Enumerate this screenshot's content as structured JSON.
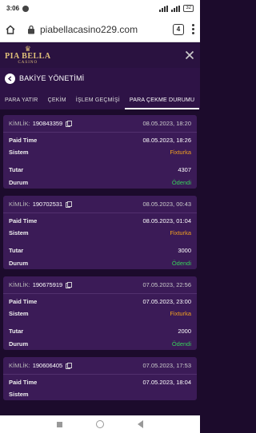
{
  "statusbar": {
    "time": "3:06",
    "battery": "32"
  },
  "browser": {
    "url": "piabellacasino229.com",
    "tab_count": "4"
  },
  "logo": {
    "name": "PIA BELLA",
    "sub": "CASINO"
  },
  "page": {
    "title": "BAKİYE YÖNETİMİ"
  },
  "tabs": [
    {
      "label": "PARA YATIR"
    },
    {
      "label": "ÇEKİM"
    },
    {
      "label": "İŞLEM GEÇMİŞİ"
    },
    {
      "label": "PARA ÇEKME DURUMU"
    }
  ],
  "labels": {
    "id": "KİMLİK:",
    "paid_time": "Paid Time",
    "system": "Sistem",
    "amount": "Tutar",
    "status": "Durum"
  },
  "transactions": [
    {
      "id": "190843359",
      "date": "08.05.2023, 18:20",
      "paid_time": "08.05.2023, 18:26",
      "system": "Fixturka",
      "amount": "4307",
      "status": "Ödendi"
    },
    {
      "id": "190702531",
      "date": "08.05.2023, 00:43",
      "paid_time": "08.05.2023, 01:04",
      "system": "Fixturka",
      "amount": "3000",
      "status": "Ödendi"
    },
    {
      "id": "190675919",
      "date": "07.05.2023, 22:56",
      "paid_time": "07.05.2023, 23:00",
      "system": "Fixturka",
      "amount": "2000",
      "status": "Ödendi"
    },
    {
      "id": "190606405",
      "date": "07.05.2023, 17:53",
      "paid_time": "07.05.2023, 18:04",
      "system": "",
      "amount": "",
      "status": ""
    }
  ],
  "colors": {
    "bg": "#1c0b2c",
    "card": "#3b1b57",
    "system": "#f0a020",
    "paid": "#38d05a"
  }
}
